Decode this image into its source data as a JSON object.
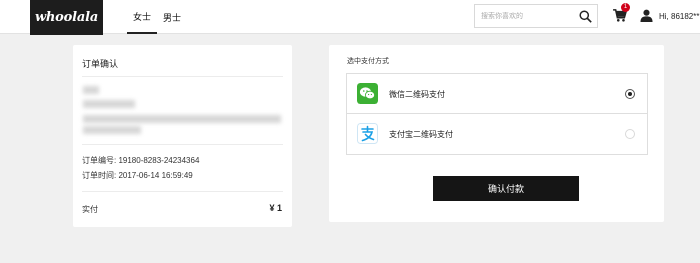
{
  "header": {
    "logo_text": "whoolala",
    "nav": [
      {
        "label": "女士",
        "active": true
      },
      {
        "label": "男士",
        "active": false
      }
    ],
    "search": {
      "placeholder": "搜索你喜欢的",
      "value": "",
      "icon": "search-icon"
    },
    "cart": {
      "icon": "cart-icon",
      "badge_count": "1"
    },
    "user": {
      "icon": "user-icon",
      "greeting": "Hi, 86182**"
    }
  },
  "order": {
    "title": "订单确认",
    "order_number": "订单编号: 19180-8283-24234364",
    "order_time": "订单时间: 2017-06-14 16:59:49",
    "pay_label": "实付",
    "pay_amount": "¥ 1"
  },
  "payment": {
    "section_title": "选中支付方式",
    "options": [
      {
        "label": "微信二维码支付",
        "icon": "wechat-icon",
        "selected": true,
        "color": "#3cb034"
      },
      {
        "label": "支付宝二维码支付",
        "icon": "alipay-icon",
        "selected": false,
        "color": "#1aa0e6"
      }
    ],
    "confirm_label": "确认付款"
  },
  "colors": {
    "page_bg": "#f0f0f0",
    "header_bg": "#ffffff",
    "logo_bg": "#1d1d1d",
    "button_bg": "#151515",
    "badge": "#d0021b"
  }
}
